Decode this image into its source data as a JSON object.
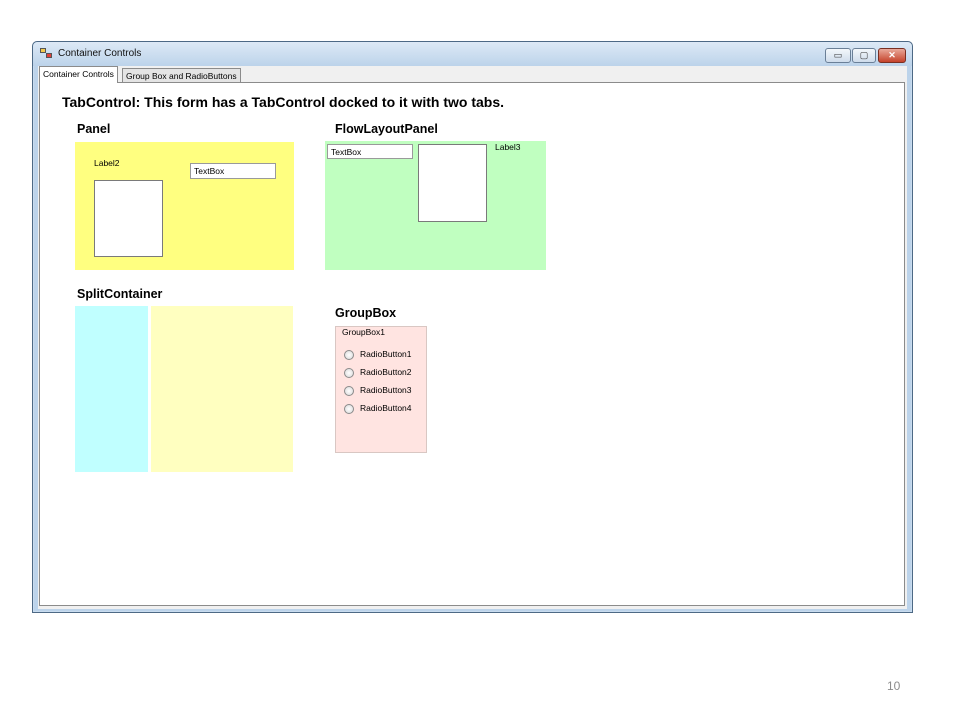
{
  "window": {
    "title": "Container Controls",
    "min_glyph": "▭",
    "max_glyph": "▢",
    "close_glyph": "✕"
  },
  "tabs": [
    {
      "label": "Container Controls",
      "selected": true
    },
    {
      "label": "Group Box and RadioButtons",
      "selected": false
    }
  ],
  "main": {
    "heading": "TabControl: This form has a TabControl docked to it with two tabs."
  },
  "panel": {
    "heading": "Panel",
    "color": "#ffff80",
    "label": "Label2",
    "textbox": "TextBox"
  },
  "flow": {
    "heading": "FlowLayoutPanel",
    "color": "#c0ffc0",
    "textbox": "TextBox",
    "label": "Label3"
  },
  "split": {
    "heading": "SplitContainer",
    "left_color": "#c0ffff",
    "right_color": "#ffffc0"
  },
  "groupbox": {
    "heading": "GroupBox",
    "title": "GroupBox1",
    "color": "#ffe4e1",
    "radios": [
      "RadioButton1",
      "RadioButton2",
      "RadioButton3",
      "RadioButton4"
    ]
  },
  "slide": {
    "number": "10"
  }
}
